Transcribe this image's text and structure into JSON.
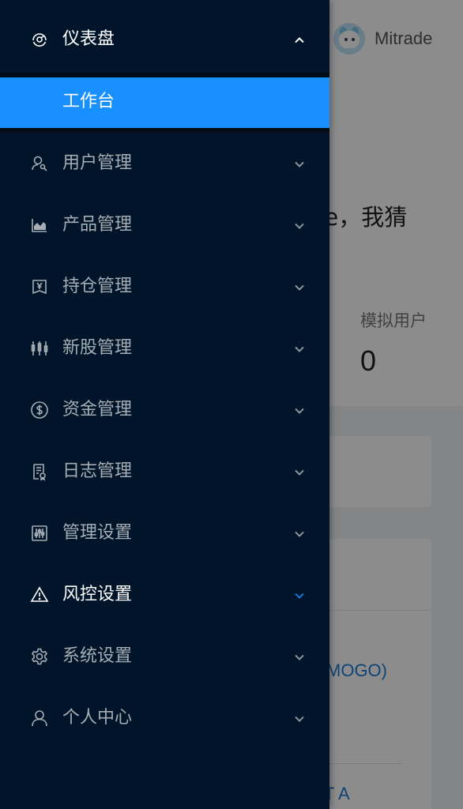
{
  "header": {
    "username": "Mitrade"
  },
  "welcome": {
    "greeting_fragment": "de，我猜"
  },
  "stats": {
    "sim_users_label": "模拟用户",
    "sim_users_value": "0"
  },
  "panels": {
    "link_fragment_1": "MOGO)",
    "link_fragment_2": "T A"
  },
  "menu": {
    "dashboard": {
      "label": "仪表盘",
      "icon": "dashboard-icon",
      "expanded": true,
      "children": [
        {
          "label": "工作台",
          "selected": true
        }
      ]
    },
    "items": [
      {
        "label": "用户管理",
        "icon": "user-manage-icon"
      },
      {
        "label": "产品管理",
        "icon": "area-chart-icon"
      },
      {
        "label": "持仓管理",
        "icon": "yen-account-icon"
      },
      {
        "label": "新股管理",
        "icon": "sliders-icon"
      },
      {
        "label": "资金管理",
        "icon": "dollar-icon"
      },
      {
        "label": "日志管理",
        "icon": "audit-log-icon"
      },
      {
        "label": "管理设置",
        "icon": "control-icon"
      },
      {
        "label": "风控设置",
        "icon": "warning-icon",
        "focused": true
      },
      {
        "label": "系统设置",
        "icon": "gear-icon"
      },
      {
        "label": "个人中心",
        "icon": "person-icon"
      }
    ]
  },
  "colors": {
    "sider_bg": "#001529",
    "submenu_bg": "#000c17",
    "selected_bg": "#1890ff",
    "text_dim": "#a6adb4",
    "text_active": "#ffffff"
  }
}
